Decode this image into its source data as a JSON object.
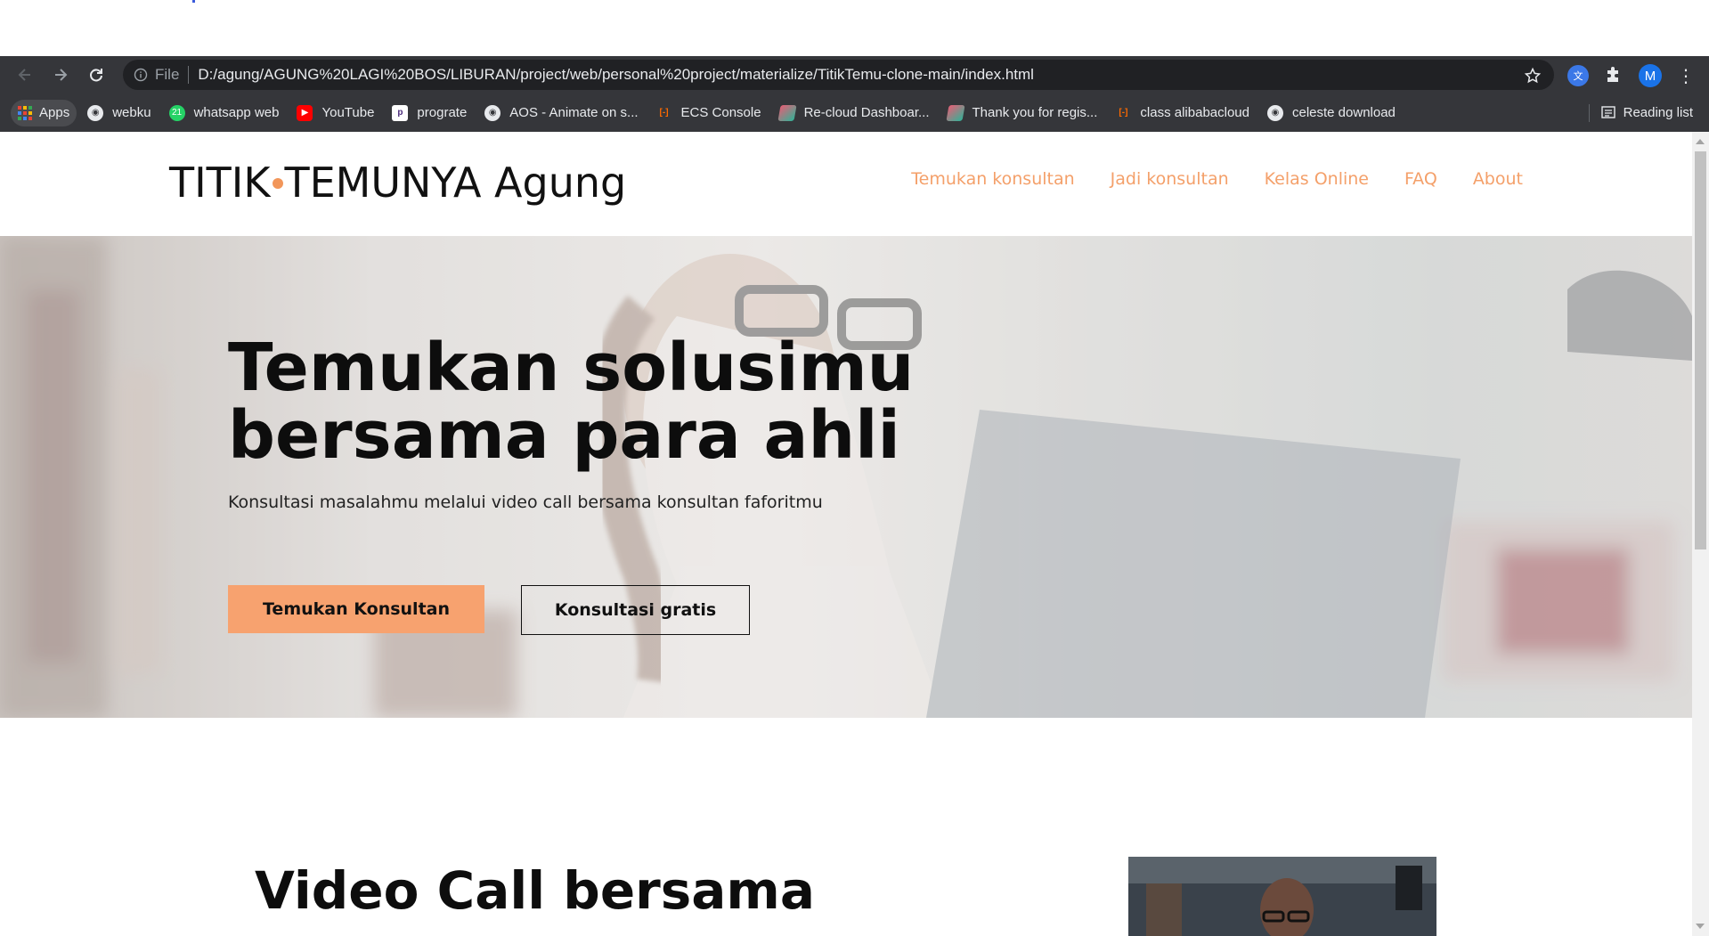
{
  "browser": {
    "omnibox": {
      "scheme_label": "File",
      "url": "D:/agung/AGUNG%20LAGI%20BOS/LIBURAN/project/web/personal%20project/materialize/TitikTemu-clone-main/index.html"
    },
    "profile_initial": "M",
    "bookmarks": [
      {
        "label": "Apps",
        "icon": "apps-grid-icon"
      },
      {
        "label": "webku",
        "icon": "globe-icon"
      },
      {
        "label": "whatsapp web",
        "icon": "whatsapp-icon",
        "badge": "21"
      },
      {
        "label": "YouTube",
        "icon": "youtube-icon"
      },
      {
        "label": "prograte",
        "icon": "prograte-icon"
      },
      {
        "label": "AOS - Animate on s...",
        "icon": "globe-icon"
      },
      {
        "label": "ECS Console",
        "icon": "alibaba-icon"
      },
      {
        "label": "Re-cloud Dashboar...",
        "icon": "recloud-icon"
      },
      {
        "label": "Thank you for regis...",
        "icon": "recloud-icon"
      },
      {
        "label": "class alibabacloud",
        "icon": "alibaba-icon"
      },
      {
        "label": "celeste download",
        "icon": "globe-icon"
      }
    ],
    "reading_list": "Reading list"
  },
  "site": {
    "logo": {
      "part1": "TITIK",
      "part2": "TEMUNYA Agung"
    },
    "nav": [
      "Temukan konsultan",
      "Jadi konsultan",
      "Kelas Online",
      "FAQ",
      "About"
    ],
    "hero": {
      "title_line1": "Temukan solusimu",
      "title_line2": "bersama para ahli",
      "subtitle": "Konsultasi masalahmu melalui video call bersama konsultan faforitmu",
      "primary_button": "Temukan Konsultan",
      "secondary_button": "Konsultasi gratis"
    },
    "section": {
      "title": "Video Call bersama"
    }
  },
  "colors": {
    "accent": "#f7a26f",
    "nav_link": "#f4a06a",
    "chrome_bg": "#35363a",
    "omnibox_bg": "#202124"
  }
}
